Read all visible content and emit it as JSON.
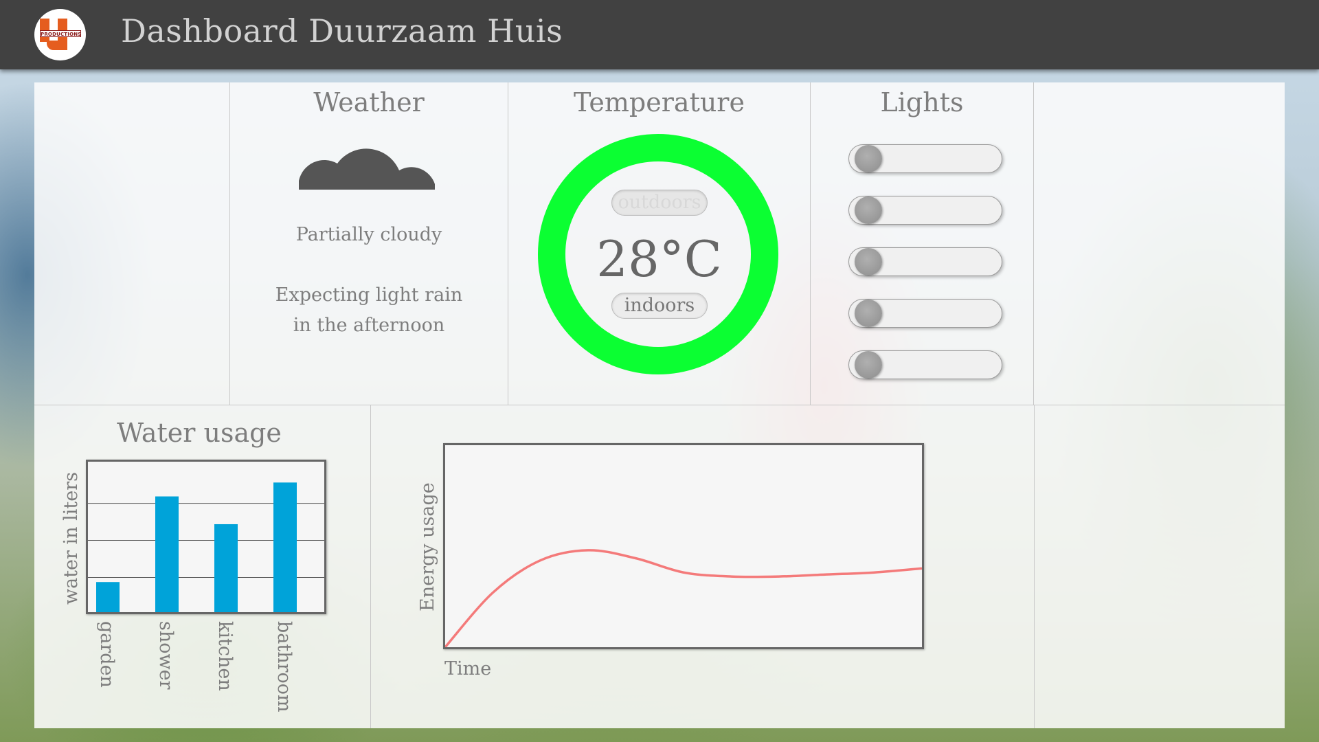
{
  "app": {
    "title": "Dashboard Duurzaam Huis",
    "logo_text": "PRODUCTIONS"
  },
  "weather": {
    "title": "Weather",
    "icon": "cloud-icon",
    "condition": "Partially cloudy",
    "forecast_line1": "Expecting light rain",
    "forecast_line2": "in the afternoon"
  },
  "temperature": {
    "title": "Temperature",
    "value": "28°C",
    "mode_outdoors": "outdoors",
    "mode_indoors": "indoors",
    "selected_mode": "indoors",
    "ring_color": "#0bff32"
  },
  "lights": {
    "title": "Lights",
    "toggles": [
      {
        "state": "off"
      },
      {
        "state": "off"
      },
      {
        "state": "off"
      },
      {
        "state": "off"
      },
      {
        "state": "off"
      }
    ]
  },
  "water": {
    "title": "Water usage",
    "ylabel": "water in liters"
  },
  "energy": {
    "xlabel": "Time",
    "ylabel": "Energy usage"
  },
  "chart_data": [
    {
      "type": "bar",
      "title": "Water usage",
      "ylabel": "water in liters",
      "xlabel": "",
      "categories": [
        "garden",
        "shower",
        "kitchen",
        "bathroom"
      ],
      "values": [
        1.3,
        5.0,
        3.8,
        5.6
      ],
      "ylim": [
        0,
        6.5
      ],
      "grid": true,
      "color": "#00a3d9"
    },
    {
      "type": "line",
      "xlabel": "Time",
      "ylabel": "Energy usage",
      "x": [
        0,
        1,
        2,
        3,
        4,
        5,
        6,
        7,
        8,
        9,
        10
      ],
      "y": [
        0,
        2.7,
        4.3,
        4.8,
        4.4,
        3.7,
        3.5,
        3.5,
        3.6,
        3.7,
        3.9
      ],
      "ylim": [
        0,
        10
      ],
      "grid": false,
      "color": "#f47a7a"
    }
  ]
}
